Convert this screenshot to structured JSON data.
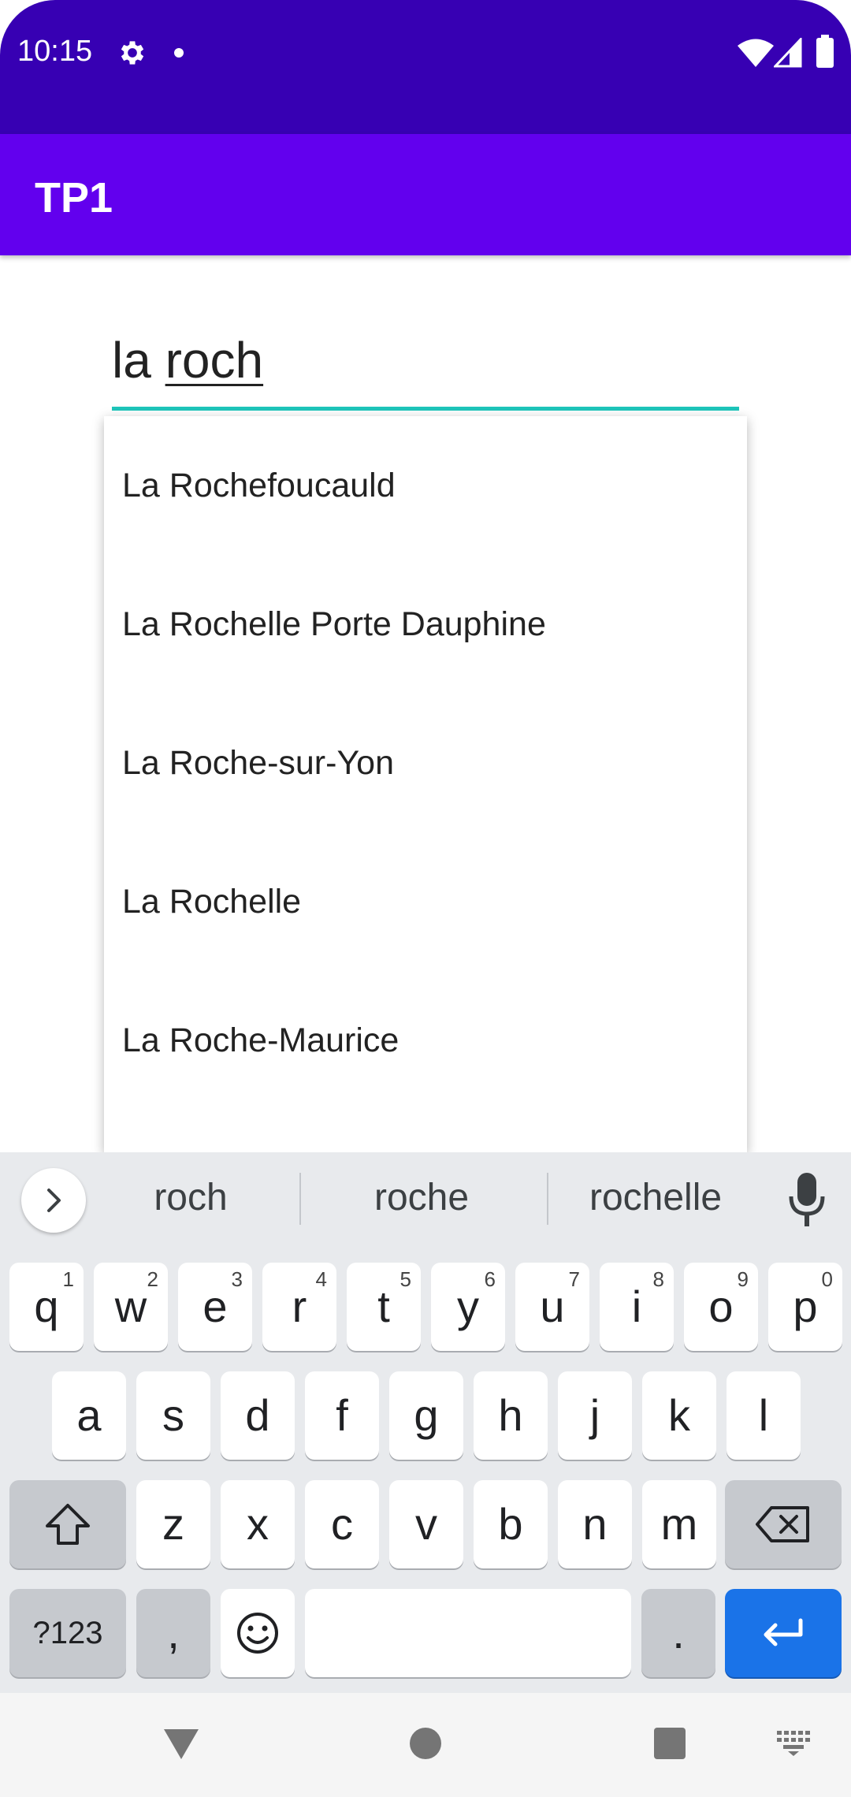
{
  "status_bar": {
    "time": "10:15",
    "icons": [
      "gear-icon",
      "notification-dot-icon",
      "wifi-icon",
      "signal-icon",
      "battery-icon"
    ],
    "background": "#3700B3"
  },
  "app_bar": {
    "title": "TP1",
    "background": "#6200EE"
  },
  "text_field": {
    "value_prefix": "la ",
    "value_composing": "roch",
    "underline_color": "#1EC5BA"
  },
  "dropdown": {
    "items": [
      {
        "label": "La Rochefoucauld"
      },
      {
        "label": "La Rochelle Porte Dauphine"
      },
      {
        "label": "La Roche-sur-Yon"
      },
      {
        "label": "La Rochelle"
      },
      {
        "label": "La Roche-Maurice"
      }
    ]
  },
  "keyboard": {
    "suggestions": [
      "roch",
      "roche",
      "rochelle"
    ],
    "rows": [
      [
        {
          "label": "q",
          "hint": "1"
        },
        {
          "label": "w",
          "hint": "2"
        },
        {
          "label": "e",
          "hint": "3"
        },
        {
          "label": "r",
          "hint": "4"
        },
        {
          "label": "t",
          "hint": "5"
        },
        {
          "label": "y",
          "hint": "6"
        },
        {
          "label": "u",
          "hint": "7"
        },
        {
          "label": "i",
          "hint": "8"
        },
        {
          "label": "o",
          "hint": "9"
        },
        {
          "label": "p",
          "hint": "0"
        }
      ],
      [
        {
          "label": "a"
        },
        {
          "label": "s"
        },
        {
          "label": "d"
        },
        {
          "label": "f"
        },
        {
          "label": "g"
        },
        {
          "label": "h"
        },
        {
          "label": "j"
        },
        {
          "label": "k"
        },
        {
          "label": "l"
        }
      ],
      [
        {
          "label": "z"
        },
        {
          "label": "x"
        },
        {
          "label": "c"
        },
        {
          "label": "v"
        },
        {
          "label": "b"
        },
        {
          "label": "n"
        },
        {
          "label": "m"
        }
      ]
    ],
    "symbols_label": "?123",
    "comma_label": ",",
    "period_label": ".",
    "enter_color": "#1A73E8",
    "background": "#E8EAED"
  },
  "nav_bar": {
    "icons": [
      "back-icon",
      "home-icon",
      "recents-icon",
      "keyboard-switch-icon"
    ]
  }
}
